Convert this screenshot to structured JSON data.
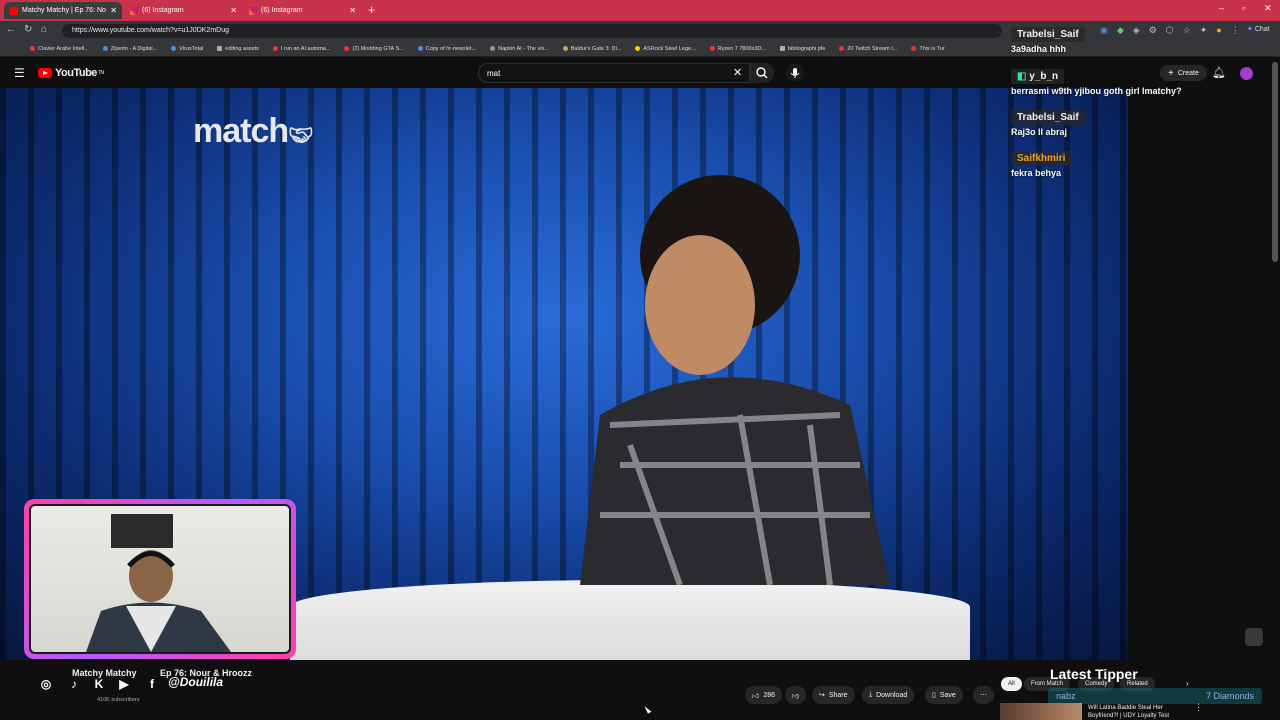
{
  "browser": {
    "tabs": [
      {
        "title": "Matchy Matchy | Ep 76: No"
      },
      {
        "title": "(6) Instagram"
      },
      {
        "title": "(6) Instagram"
      }
    ],
    "url": "https://www.youtube.com/watch?v=u1J0DK2mDug",
    "bookmarks": [
      "Clavier Arabe Intell...",
      "Ziperto - A Digital...",
      "VirusTotal",
      "editing assets",
      "I run an AI automa...",
      "(2) Modding GTA S...",
      "Copy of hr-newslet...",
      "Napkin AI - The vis...",
      "Baldur's Gate 3: Di...",
      "ASRock Steel Lege...",
      "Ryzen 7 7800x3D...",
      "bibliographi pfe",
      "20 Twitch Stream I...",
      "This is Tur"
    ],
    "chat_button": "Chat"
  },
  "youtube": {
    "logo_text": "YouTube",
    "logo_sup": "TN",
    "search_value": "mat",
    "create_label": "Create",
    "video_logo": "match",
    "channel_name": "Matchy Matchy",
    "video_title": "Ep 76: Nour & Hroozz",
    "subscribers": "410K subscribers",
    "likes": "286",
    "share": "Share",
    "download": "Download",
    "save": "Save",
    "filter_chips": [
      "All",
      "From Match",
      "Comedy",
      "Related"
    ],
    "rec_title": "Will Latina Baddie Steal Her Boyfriend?! | UDY Loyalty Test"
  },
  "overlay": {
    "chat": [
      {
        "name": "Trabelsi_Saif",
        "msg": "3a9adha hhh",
        "color": "#ffffff"
      },
      {
        "name": "y_b_n",
        "msg": "berrasmi w9th yjibou goth girl lmatchy?",
        "color": "#ffffff"
      },
      {
        "name": "Trabelsi_Saif",
        "msg": "Raj3o ll abraj",
        "color": "#ffffff"
      },
      {
        "name": "Saifkhmiri",
        "msg": "fekra behya",
        "color": "#f0a020"
      }
    ],
    "handle": "@Douilila",
    "latest_tipper": "Latest Tipper",
    "tipper_name": "nabz",
    "tipper_amount": "7 Diamonds"
  }
}
